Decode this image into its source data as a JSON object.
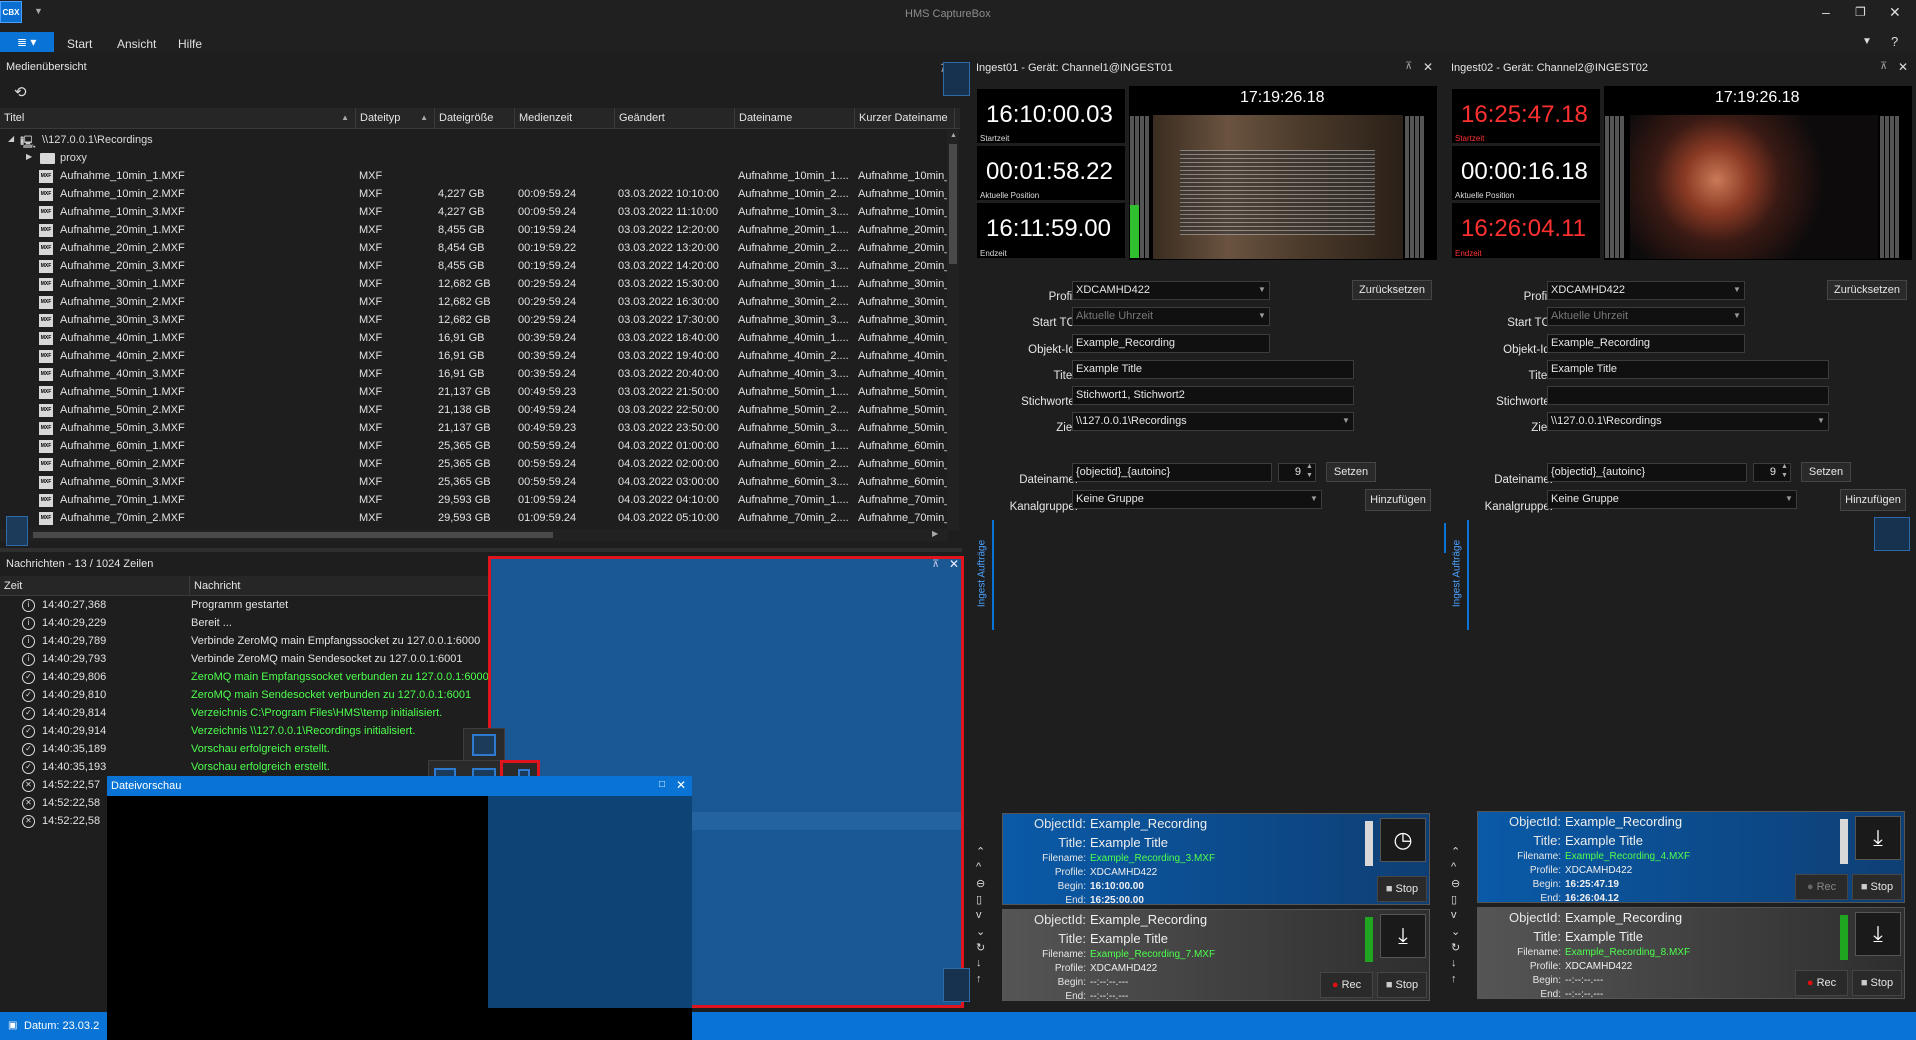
{
  "app": {
    "title": "HMS CaptureBox",
    "logo": "CBX"
  },
  "menu": {
    "items": [
      "Start",
      "Ansicht",
      "Hilfe"
    ]
  },
  "media": {
    "title": "Medienübersicht",
    "columns": [
      "Titel",
      "Dateityp",
      "Dateigröße",
      "Medienzeit",
      "Geändert",
      "Dateiname",
      "Kurzer Dateiname"
    ],
    "root": "\\\\127.0.0.1\\Recordings",
    "folder": "proxy",
    "rows": [
      [
        "Aufnahme_10min_1.MXF",
        "MXF",
        "",
        "",
        "",
        "Aufnahme_10min_1....",
        "Aufnahme_10min_"
      ],
      [
        "Aufnahme_10min_2.MXF",
        "MXF",
        "4,227 GB",
        "00:09:59.24",
        "03.03.2022 10:10:00",
        "Aufnahme_10min_2....",
        "Aufnahme_10min_"
      ],
      [
        "Aufnahme_10min_3.MXF",
        "MXF",
        "4,227 GB",
        "00:09:59.24",
        "03.03.2022 11:10:00",
        "Aufnahme_10min_3....",
        "Aufnahme_10min_"
      ],
      [
        "Aufnahme_20min_1.MXF",
        "MXF",
        "8,455 GB",
        "00:19:59.24",
        "03.03.2022 12:20:00",
        "Aufnahme_20min_1....",
        "Aufnahme_20min_"
      ],
      [
        "Aufnahme_20min_2.MXF",
        "MXF",
        "8,454 GB",
        "00:19:59.22",
        "03.03.2022 13:20:00",
        "Aufnahme_20min_2....",
        "Aufnahme_20min_"
      ],
      [
        "Aufnahme_20min_3.MXF",
        "MXF",
        "8,455 GB",
        "00:19:59.24",
        "03.03.2022 14:20:00",
        "Aufnahme_20min_3....",
        "Aufnahme_20min_"
      ],
      [
        "Aufnahme_30min_1.MXF",
        "MXF",
        "12,682 GB",
        "00:29:59.24",
        "03.03.2022 15:30:00",
        "Aufnahme_30min_1....",
        "Aufnahme_30min_"
      ],
      [
        "Aufnahme_30min_2.MXF",
        "MXF",
        "12,682 GB",
        "00:29:59.24",
        "03.03.2022 16:30:00",
        "Aufnahme_30min_2....",
        "Aufnahme_30min_"
      ],
      [
        "Aufnahme_30min_3.MXF",
        "MXF",
        "12,682 GB",
        "00:29:59.24",
        "03.03.2022 17:30:00",
        "Aufnahme_30min_3....",
        "Aufnahme_30min_"
      ],
      [
        "Aufnahme_40min_1.MXF",
        "MXF",
        "16,91 GB",
        "00:39:59.24",
        "03.03.2022 18:40:00",
        "Aufnahme_40min_1....",
        "Aufnahme_40min_"
      ],
      [
        "Aufnahme_40min_2.MXF",
        "MXF",
        "16,91 GB",
        "00:39:59.24",
        "03.03.2022 19:40:00",
        "Aufnahme_40min_2....",
        "Aufnahme_40min_"
      ],
      [
        "Aufnahme_40min_3.MXF",
        "MXF",
        "16,91 GB",
        "00:39:59.24",
        "03.03.2022 20:40:00",
        "Aufnahme_40min_3....",
        "Aufnahme_40min_"
      ],
      [
        "Aufnahme_50min_1.MXF",
        "MXF",
        "21,137 GB",
        "00:49:59.23",
        "03.03.2022 21:50:00",
        "Aufnahme_50min_1....",
        "Aufnahme_50min_"
      ],
      [
        "Aufnahme_50min_2.MXF",
        "MXF",
        "21,138 GB",
        "00:49:59.24",
        "03.03.2022 22:50:00",
        "Aufnahme_50min_2....",
        "Aufnahme_50min_"
      ],
      [
        "Aufnahme_50min_3.MXF",
        "MXF",
        "21,137 GB",
        "00:49:59.23",
        "03.03.2022 23:50:00",
        "Aufnahme_50min_3....",
        "Aufnahme_50min_"
      ],
      [
        "Aufnahme_60min_1.MXF",
        "MXF",
        "25,365 GB",
        "00:59:59.24",
        "04.03.2022 01:00:00",
        "Aufnahme_60min_1....",
        "Aufnahme_60min_"
      ],
      [
        "Aufnahme_60min_2.MXF",
        "MXF",
        "25,365 GB",
        "00:59:59.24",
        "04.03.2022 02:00:00",
        "Aufnahme_60min_2....",
        "Aufnahme_60min_"
      ],
      [
        "Aufnahme_60min_3.MXF",
        "MXF",
        "25,365 GB",
        "00:59:59.24",
        "04.03.2022 03:00:00",
        "Aufnahme_60min_3....",
        "Aufnahme_60min_"
      ],
      [
        "Aufnahme_70min_1.MXF",
        "MXF",
        "29,593 GB",
        "01:09:59.24",
        "04.03.2022 04:10:00",
        "Aufnahme_70min_1....",
        "Aufnahme_70min_"
      ],
      [
        "Aufnahme_70min_2.MXF",
        "MXF",
        "29,593 GB",
        "01:09:59.24",
        "04.03.2022 05:10:00",
        "Aufnahme_70min_2....",
        "Aufnahme_70min_"
      ]
    ]
  },
  "messages": {
    "title": "Nachrichten - 13 / 1024 Zeilen",
    "col_time": "Zeit",
    "col_msg": "Nachricht",
    "rows": [
      {
        "t": "14:40:27,368",
        "m": "Programm gestartet",
        "type": "info"
      },
      {
        "t": "14:40:29,229",
        "m": "Bereit ...",
        "type": "info"
      },
      {
        "t": "14:40:29,789",
        "m": "Verbinde ZeroMQ main Empfangssocket zu 127.0.0.1:6000",
        "type": "info"
      },
      {
        "t": "14:40:29,793",
        "m": "Verbinde ZeroMQ main Sendesocket zu 127.0.0.1:6001",
        "type": "info"
      },
      {
        "t": "14:40:29,806",
        "m": "ZeroMQ main Empfangssocket verbunden zu 127.0.0.1:6000",
        "type": "ok"
      },
      {
        "t": "14:40:29,810",
        "m": "ZeroMQ main Sendesocket verbunden zu 127.0.0.1:6001",
        "type": "ok"
      },
      {
        "t": "14:40:29,814",
        "m": "Verzeichnis C:\\Program Files\\HMS\\temp initialisiert.",
        "type": "ok"
      },
      {
        "t": "14:40:29,914",
        "m": "Verzeichnis \\\\127.0.0.1\\Recordings initialisiert.",
        "type": "ok"
      },
      {
        "t": "14:40:35,189",
        "m": "Vorschau erfolgreich erstellt.",
        "type": "ok"
      },
      {
        "t": "14:40:35,193",
        "m": "Vorschau erfolgreich erstellt.",
        "type": "ok"
      },
      {
        "t": "14:52:22,57",
        "m": "",
        "type": "err"
      },
      {
        "t": "14:52:22,58",
        "m": "",
        "type": "err"
      },
      {
        "t": "14:52:22,58",
        "m": "",
        "type": "err"
      }
    ]
  },
  "preview": {
    "title": "Dateivorschau"
  },
  "status": {
    "date": "Datum: 23.03.2"
  },
  "ingest": [
    {
      "title": "Ingest01 - Gerät: Channel1@INGEST01",
      "clock": "17:19:26.18",
      "startzeit": "16:10:00.03",
      "start_label": "Startzeit",
      "start_color": "#ffffff",
      "position": "00:01:58.22",
      "pos_label": "Aktuelle Position",
      "endzeit": "16:11:59.00",
      "end_label": "Endzeit",
      "end_color": "#ffffff",
      "form": {
        "profil": "XDCAMHD422",
        "starttc": "Aktuelle Uhrzeit",
        "objektid": "Example_Recording",
        "titel": "Example Title",
        "stichworte": "Stichwort1, Stichwort2",
        "ziel": "\\\\127.0.0.1\\Recordings",
        "dateiname": "{objectid}_{autoinc}",
        "num": "9",
        "kanalgruppe": "Keine Gruppe"
      },
      "jobs": [
        {
          "objectid": "Example_Recording",
          "title": "Example Title",
          "filename": "Example_Recording_3.MXF",
          "profile": "XDCAMHD422",
          "begin": "16:10:00.00",
          "end": "16:25:00.00",
          "active": true,
          "icon": "clock-icon"
        },
        {
          "objectid": "Example_Recording",
          "title": "Example Title",
          "filename": "Example_Recording_7.MXF",
          "profile": "XDCAMHD422",
          "begin": "--:--:--.---",
          "end": "--:--:--.---",
          "active": false,
          "icon": "download-icon"
        }
      ]
    },
    {
      "title": "Ingest02 - Gerät: Channel2@INGEST02",
      "clock": "17:19:26.18",
      "startzeit": "16:25:47.18",
      "start_label": "Startzeit",
      "start_color": "#ff3030",
      "position": "00:00:16.18",
      "pos_label": "Aktuelle Position",
      "endzeit": "16:26:04.11",
      "end_label": "Endzeit",
      "end_color": "#ff3030",
      "form": {
        "profil": "XDCAMHD422",
        "starttc": "Aktuelle Uhrzeit",
        "objektid": "Example_Recording",
        "titel": "Example Title",
        "stichworte": "",
        "ziel": "\\\\127.0.0.1\\Recordings",
        "dateiname": "{objectid}_{autoinc}",
        "num": "9",
        "kanalgruppe": "Keine Gruppe"
      },
      "jobs": [
        {
          "objectid": "Example_Recording",
          "title": "Example Title",
          "filename": "Example_Recording_4.MXF",
          "profile": "XDCAMHD422",
          "begin": "16:25:47.19",
          "end": "16:26:04.12",
          "active": true,
          "icon": "download-icon"
        },
        {
          "objectid": "Example_Recording",
          "title": "Example Title",
          "filename": "Example_Recording_8.MXF",
          "profile": "XDCAMHD422",
          "begin": "--:--:--.---",
          "end": "--:--:--.---",
          "active": false,
          "icon": "download-icon"
        }
      ]
    }
  ],
  "labels": {
    "profil": "Profil:",
    "starttc": "Start TC:",
    "objektid": "Objekt-Id:",
    "titel": "Titel:",
    "stichworte": "Stichworte:",
    "ziel": "Ziel:",
    "dateiname": "Dateiname:",
    "kanalgruppe": "Kanalgruppe:",
    "reset": "Zurücksetzen",
    "setzen": "Setzen",
    "hinzufuegen": "Hinzufügen",
    "side_tab": "Ingest Aufträge",
    "job_objectid": "ObjectId:",
    "job_title": "Title:",
    "job_filename": "Filename:",
    "job_profile": "Profile:",
    "job_begin": "Begin:",
    "job_end": "End:",
    "rec": "Rec",
    "stop": "Stop"
  },
  "colors": {
    "accent": "#0a74d6",
    "dock_overlay": "#1a5c9a",
    "highlight": "#e0141c",
    "job_active": "#0f5fb0",
    "job_idle": "#3c3c3c"
  }
}
